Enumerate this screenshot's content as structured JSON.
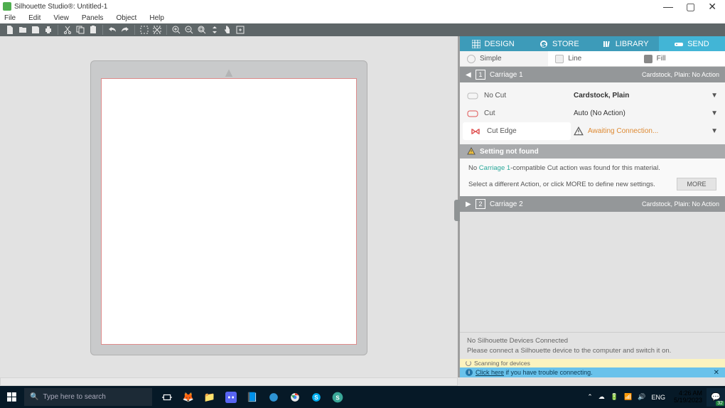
{
  "window": {
    "title": "Silhouette Studio®: Untitled-1",
    "min": "—",
    "max": "▢",
    "close": "✕"
  },
  "menu": [
    "File",
    "Edit",
    "View",
    "Panels",
    "Object",
    "Help"
  ],
  "tabs": {
    "design": "DESIGN",
    "store": "STORE",
    "library": "LIBRARY",
    "send": "SEND"
  },
  "subtabs": {
    "simple": "Simple",
    "line": "Line",
    "fill": "Fill"
  },
  "carriage1": {
    "title": "Carriage 1",
    "info": "Cardstock, Plain: No Action",
    "actions": {
      "nocut": "No Cut",
      "cut": "Cut",
      "edge": "Cut Edge"
    },
    "material": "Cardstock, Plain",
    "mode": "Auto (No Action)",
    "status": "Awaiting Connection..."
  },
  "warn": {
    "title": "Setting not found",
    "prefix": "No ",
    "link": "Carriage 1",
    "suffix": "-compatible Cut action was found for this material.",
    "line2": "Select a different Action, or click MORE to define new settings.",
    "more": "MORE"
  },
  "carriage2": {
    "title": "Carriage 2",
    "info": "Cardstock, Plain: No Action"
  },
  "status": {
    "l1": "No Silhouette Devices Connected",
    "l2": "Please connect a Silhouette device to the computer and switch it on."
  },
  "scan": "Scanning for devices",
  "clickbar": {
    "link": "Click here",
    "rest": " if you have trouble connecting."
  },
  "taskbar": {
    "search_placeholder": "Type here to search",
    "lang": "ENG",
    "time": "4:26 AM",
    "date": "5/19/2023",
    "notif_count": "32"
  }
}
